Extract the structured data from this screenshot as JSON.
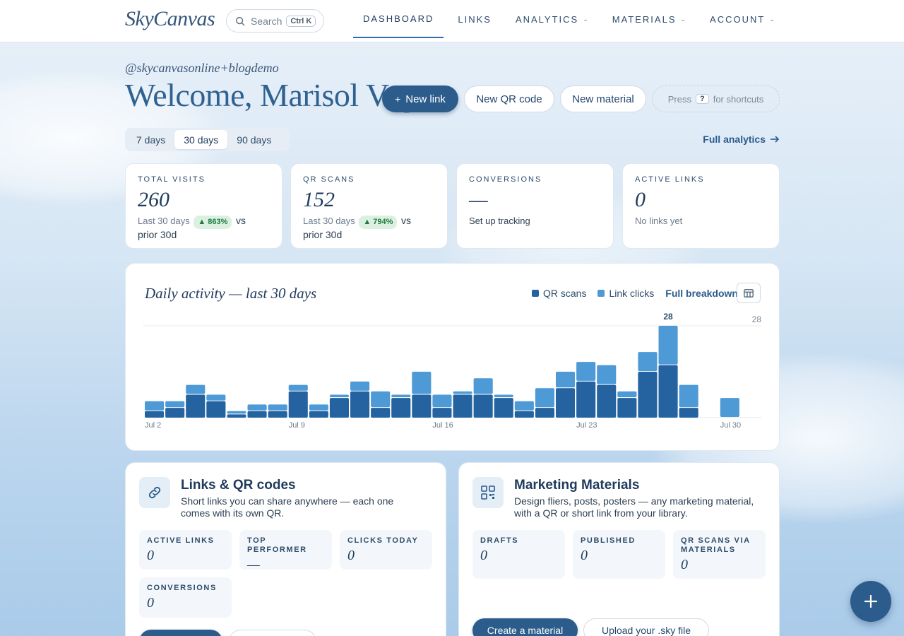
{
  "brand": "SkyCanvas",
  "search": {
    "label": "Search",
    "shortcut": "Ctrl K"
  },
  "nav": [
    {
      "label": "DASHBOARD",
      "active": true,
      "dropdown": false
    },
    {
      "label": "LINKS",
      "active": false,
      "dropdown": false
    },
    {
      "label": "ANALYTICS",
      "active": false,
      "dropdown": true
    },
    {
      "label": "MATERIALS",
      "active": false,
      "dropdown": true
    },
    {
      "label": "ACCOUNT",
      "active": false,
      "dropdown": true
    }
  ],
  "header": {
    "handle": "@skycanvasonline+blogdemo",
    "welcome": "Welcome, Marisol Vega",
    "new_link": "New link",
    "new_qr": "New QR code",
    "new_material": "New material",
    "shortcut_pre": "Press",
    "shortcut_key": "?",
    "shortcut_post": "for shortcuts"
  },
  "ranges": [
    "7 days",
    "30 days",
    "90 days"
  ],
  "active_range": "30 days",
  "full_analytics": "Full analytics",
  "stats": [
    {
      "label": "TOTAL VISITS",
      "value": "260",
      "sub_pre": "Last 30 days",
      "badge": "▲ 863%",
      "sub_post": "vs",
      "sub_line2": "prior 30d"
    },
    {
      "label": "QR SCANS",
      "value": "152",
      "sub_pre": "Last 30 days",
      "badge": "▲ 794%",
      "sub_post": "vs",
      "sub_line2": "prior 30d"
    },
    {
      "label": "CONVERSIONS",
      "value": "—",
      "sub_text": "Set up tracking"
    },
    {
      "label": "ACTIVE LINKS",
      "value": "0",
      "sub_text": "No links yet"
    }
  ],
  "activity": {
    "title": "Daily activity — last 30 days",
    "legend_qr": "QR scans",
    "legend_links": "Link clicks",
    "breakdown": "Full breakdown",
    "peak_label": "28",
    "axis_max_label": "28"
  },
  "colors": {
    "qr": "#2563a0",
    "links": "#4e9ad6",
    "primary": "#2b5c8c"
  },
  "chart_data": {
    "type": "bar",
    "stacked": true,
    "x_tick_labels": [
      "Jul 2",
      "Jul 9",
      "Jul 16",
      "Jul 23",
      "Jul 30"
    ],
    "categories": [
      "Jul 2",
      "Jul 3",
      "Jul 4",
      "Jul 5",
      "Jul 6",
      "Jul 7",
      "Jul 8",
      "Jul 9",
      "Jul 10",
      "Jul 11",
      "Jul 12",
      "Jul 13",
      "Jul 14",
      "Jul 15",
      "Jul 16",
      "Jul 17",
      "Jul 18",
      "Jul 19",
      "Jul 20",
      "Jul 21",
      "Jul 22",
      "Jul 23",
      "Jul 24",
      "Jul 25",
      "Jul 26",
      "Jul 27",
      "Jul 28",
      "Jul 29",
      "Jul 30",
      "Jul 31"
    ],
    "series": [
      {
        "name": "QR scans",
        "values": [
          2,
          3,
          7,
          5,
          1,
          2,
          2,
          8,
          2,
          6,
          8,
          3,
          6,
          7,
          3,
          7,
          7,
          6,
          2,
          3,
          9,
          11,
          10,
          6,
          14,
          16,
          3,
          0,
          0,
          0
        ]
      },
      {
        "name": "Link clicks",
        "values": [
          3,
          2,
          3,
          2,
          1,
          2,
          2,
          2,
          2,
          1,
          3,
          5,
          1,
          7,
          4,
          1,
          5,
          1,
          3,
          6,
          5,
          6,
          6,
          2,
          6,
          12,
          7,
          0,
          6,
          0
        ]
      }
    ],
    "ylim": [
      0,
      28
    ]
  },
  "links_panel": {
    "title": "Links & QR codes",
    "desc_line1": "Short links you can share anywhere — each one",
    "desc_line2": "comes with its own QR.",
    "metrics": [
      {
        "label": "ACTIVE LINKS",
        "value": "0"
      },
      {
        "label": "TOP PERFORMER",
        "value": "—"
      },
      {
        "label": "CLICKS TODAY",
        "value": "0"
      },
      {
        "label": "CONVERSIONS",
        "value": "0"
      }
    ]
  },
  "materials_panel": {
    "title": "Marketing Materials",
    "desc_line1": "Design fliers, posts, posters — any marketing material,",
    "desc_line2": "with a QR or short link from your library.",
    "metrics": [
      {
        "label": "DRAFTS",
        "value": "0"
      },
      {
        "label": "PUBLISHED",
        "value": "0"
      },
      {
        "label": "QR SCANS VIA",
        "label2": "MATERIALS",
        "value": "0"
      }
    ],
    "create": "Create a material",
    "upload": "Upload your .sky file"
  }
}
